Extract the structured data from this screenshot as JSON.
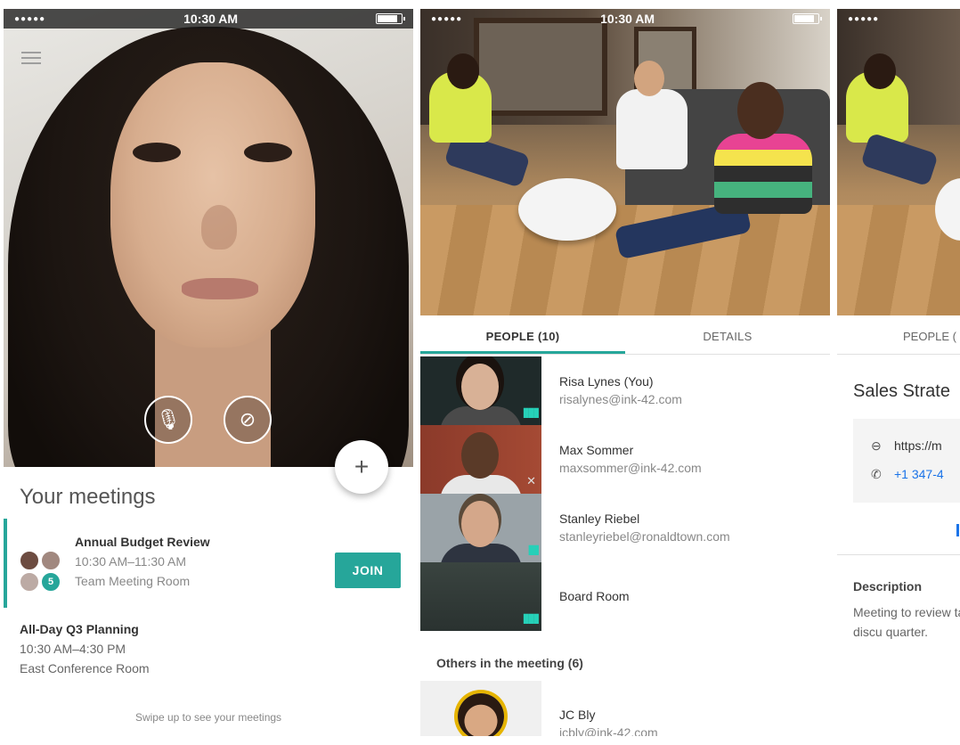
{
  "status_bar": {
    "signal": "●●●●●",
    "wifi": "wifi-icon",
    "time": "10:30 AM"
  },
  "screen1": {
    "mic_icon": "🎙",
    "cam_icon": "⊘",
    "fab_icon": "+",
    "meetings_title": "Your meetings",
    "meetings": [
      {
        "title": "Annual Budget Review",
        "time": "10:30 AM–11:30 AM",
        "room": "Team Meeting Room",
        "extra_count": "5",
        "join_label": "JOIN"
      },
      {
        "title": "All-Day Q3 Planning",
        "time": "10:30 AM–4:30 PM",
        "room": "East Conference Room"
      }
    ],
    "swipe_hint": "Swipe up to see your meetings"
  },
  "screen2": {
    "tabs": [
      "PEOPLE (10)",
      "DETAILS"
    ],
    "active_tab": 0,
    "people": [
      {
        "name": "Risa Lynes (You)",
        "email": "risalynes@ink-42.com"
      },
      {
        "name": "Max Sommer",
        "email": "maxsommer@ink-42.com"
      },
      {
        "name": "Stanley Riebel",
        "email": "stanleyriebel@ronaldtown.com"
      },
      {
        "name": "Board Room",
        "email": ""
      }
    ],
    "others_label": "Others in the meeting  (6)",
    "others": [
      {
        "name": "JC Bly",
        "email": "jcbly@ink-42.com"
      }
    ]
  },
  "screen3": {
    "tab": "PEOPLE (",
    "title": "Sales Strate",
    "link": "https://m",
    "phone": "+1 347-4",
    "description_label": "Description",
    "description": "Meeting to review targets and discu quarter."
  },
  "colors": {
    "accent": "#26a69a",
    "link": "#1a73e8"
  }
}
